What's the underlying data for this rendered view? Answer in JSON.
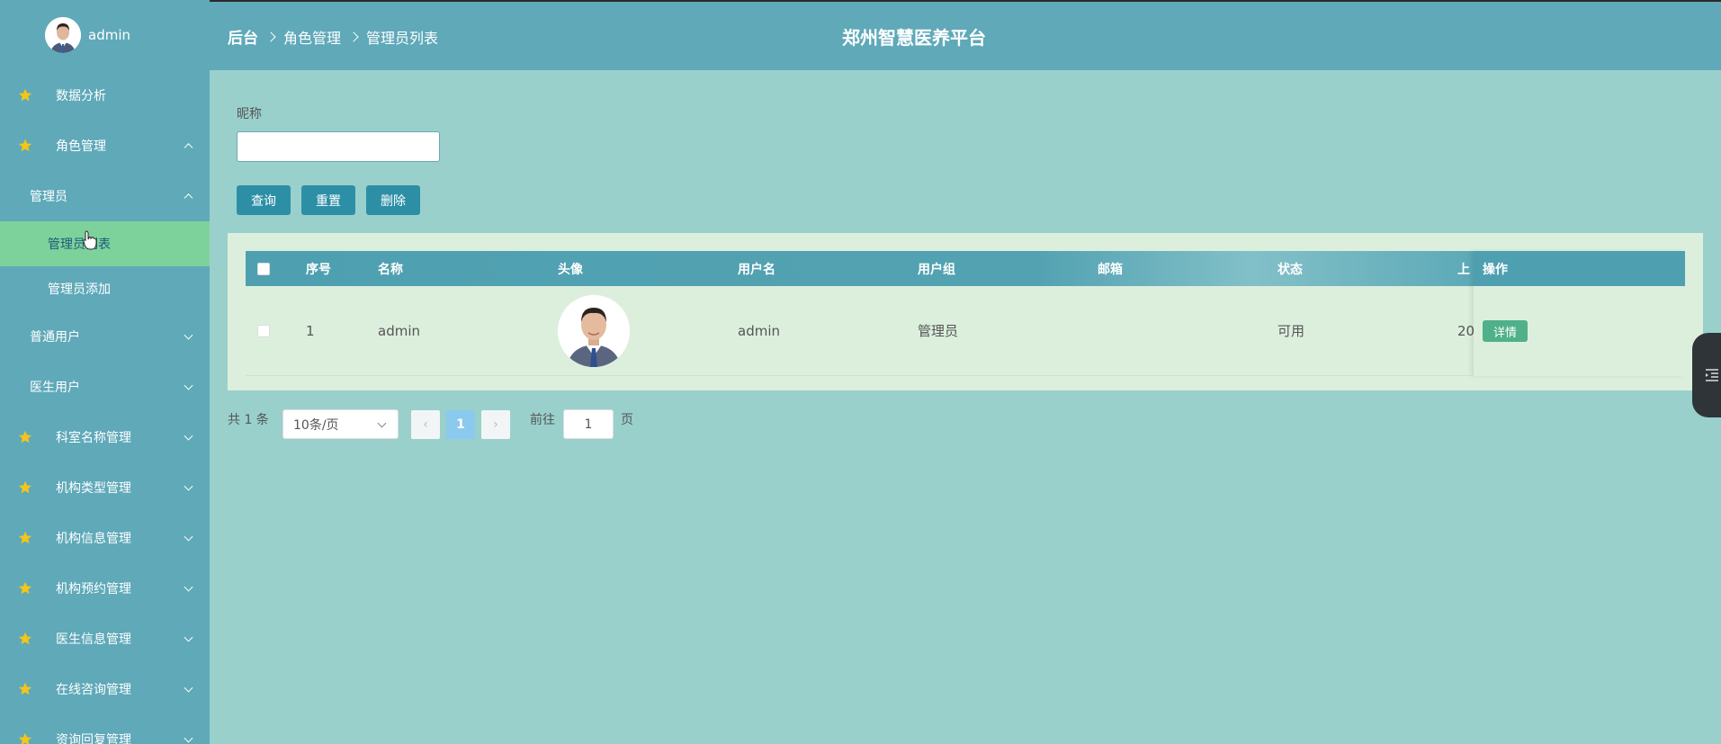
{
  "user": {
    "name": "admin"
  },
  "sidebar": {
    "items": [
      {
        "label": "数据分析",
        "level": 1,
        "star": true,
        "chevron": "none"
      },
      {
        "label": "角色管理",
        "level": 1,
        "star": true,
        "chevron": "up"
      },
      {
        "label": "管理员",
        "level": 2,
        "star": false,
        "chevron": "up"
      },
      {
        "label": "管理员列表",
        "level": 3,
        "star": false,
        "chevron": "none",
        "active": true
      },
      {
        "label": "管理员添加",
        "level": 3,
        "star": false,
        "chevron": "none"
      },
      {
        "label": "普通用户",
        "level": 2,
        "star": false,
        "chevron": "down"
      },
      {
        "label": "医生用户",
        "level": 2,
        "star": false,
        "chevron": "down"
      },
      {
        "label": "科室名称管理",
        "level": 1,
        "star": true,
        "chevron": "down"
      },
      {
        "label": "机构类型管理",
        "level": 1,
        "star": true,
        "chevron": "down"
      },
      {
        "label": "机构信息管理",
        "level": 1,
        "star": true,
        "chevron": "down"
      },
      {
        "label": "机构预约管理",
        "level": 1,
        "star": true,
        "chevron": "down"
      },
      {
        "label": "医生信息管理",
        "level": 1,
        "star": true,
        "chevron": "down"
      },
      {
        "label": "在线咨询管理",
        "level": 1,
        "star": true,
        "chevron": "down"
      },
      {
        "label": "资询回复管理",
        "level": 1,
        "star": true,
        "chevron": "down"
      }
    ]
  },
  "header": {
    "breadcrumb": [
      "后台",
      "角色管理",
      "管理员列表"
    ],
    "site_title": "郑州智慧医养平台"
  },
  "search": {
    "label": "昵称",
    "value": "",
    "placeholder": ""
  },
  "toolbar": {
    "query_label": "查询",
    "reset_label": "重置",
    "delete_label": "删除"
  },
  "table": {
    "columns": [
      "序号",
      "名称",
      "头像",
      "用户名",
      "用户组",
      "邮箱",
      "状态",
      "上",
      "操作"
    ],
    "rows": [
      {
        "index": "1",
        "name": "admin",
        "username": "admin",
        "group": "管理员",
        "email": "",
        "status": "可用",
        "truncated": "20",
        "action": "详情"
      }
    ]
  },
  "pagination": {
    "total_text": "共 1 条",
    "page_size": "10条/页",
    "current_page": "1",
    "goto_label": "前往",
    "goto_value": "1",
    "page_suffix": "页",
    "prev_icon": "‹",
    "next_icon": "›"
  },
  "colors": {
    "sidebar_bg": "#5fa9b9",
    "main_bg": "#99d0cc",
    "active_item": "#7dd29b",
    "table_header": "#4ea0b0",
    "button": "#2d8fa6",
    "detail_button": "#4fb08a",
    "star": "#f5c518"
  }
}
